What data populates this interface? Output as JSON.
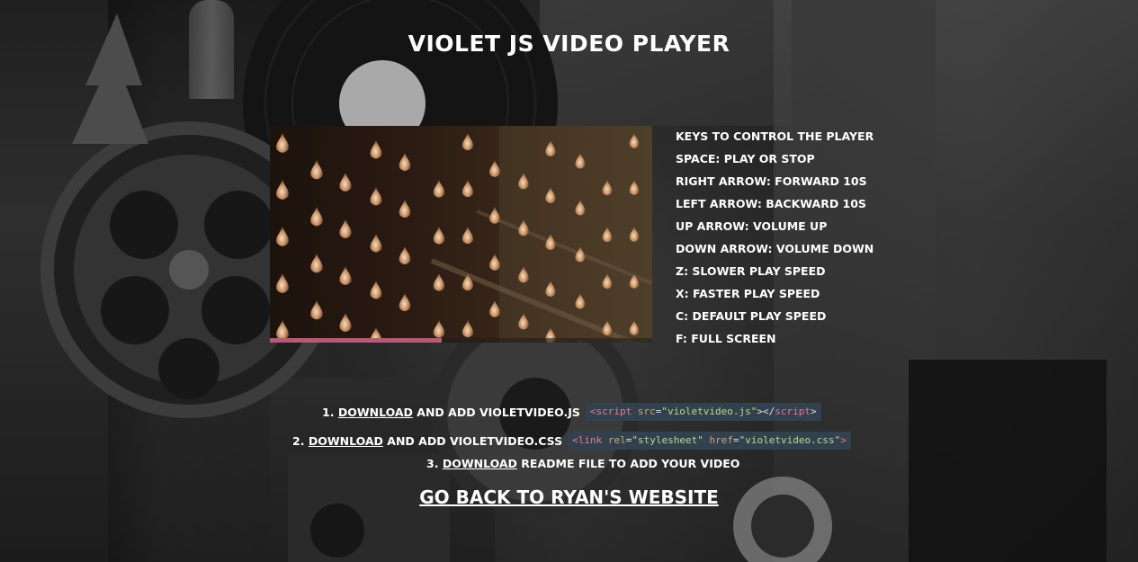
{
  "page": {
    "title": "Violet JS Video Player"
  },
  "video": {
    "progress": 0.45,
    "progress_color": "#b55a78"
  },
  "keys": {
    "heading": "Keys to control the player",
    "items": [
      "Space: play or stop",
      "Right arrow: forward 10s",
      "Left arrow: backward 10s",
      "Up arrow: volume up",
      "Down arrow: volume down",
      "Z: slower play speed",
      "X: faster play speed",
      "C: default play speed",
      "F: full screen"
    ]
  },
  "steps": [
    {
      "number": "1.",
      "link_label": "Download",
      "text": "and add violetvideo.js",
      "code": {
        "tag_open": "<script",
        "attr": "src",
        "eq": "=",
        "value": "\"violetvideo.js\"",
        "tag_mid": "></",
        "tag_name": "script",
        "tag_close": ">"
      }
    },
    {
      "number": "2.",
      "link_label": "Download",
      "text": "and add violetvideo.css",
      "code": {
        "tag_open": "<link",
        "attr1": "rel",
        "value1": "\"stylesheet\"",
        "attr2": "href",
        "value2": "\"violetvideo.css\"",
        "tag_close": ">"
      }
    },
    {
      "number": "3.",
      "link_label": "Download",
      "text": "readme file to add your video"
    }
  ],
  "back_link": {
    "label": "Go back to Ryan's website"
  },
  "colors": {
    "code_background": "#33414f",
    "code_tag": "#e07b8e",
    "code_attr": "#c9a57a",
    "code_string": "#b9d98c"
  }
}
